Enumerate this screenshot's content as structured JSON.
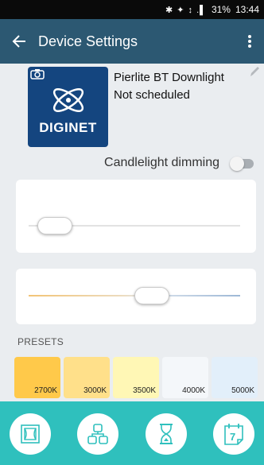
{
  "status_bar": {
    "icons": "✱ ✦ ↕ .▌",
    "battery": "31%",
    "time": "13:44"
  },
  "app_bar": {
    "title": "Device Settings",
    "back_icon": "arrow-left-icon",
    "menu_icon": "more-vert-icon"
  },
  "device": {
    "logo_text": "DIGINET",
    "name": "Pierlite BT Downlight",
    "schedule_status": "Not scheduled"
  },
  "candlelight": {
    "label": "Candlelight dimming",
    "enabled": false
  },
  "brightness_slider": {
    "value": 0.05
  },
  "temperature_slider": {
    "value": 0.6
  },
  "presets": {
    "label": "PRESETS",
    "items": [
      {
        "label": "2700K",
        "color": "#ffc94a"
      },
      {
        "label": "3000K",
        "color": "#ffe08a"
      },
      {
        "label": "3500K",
        "color": "#fff7b5"
      },
      {
        "label": "4000K",
        "color": "#f4f7fa"
      },
      {
        "label": "5000K",
        "color": "#e2effa"
      }
    ]
  },
  "bottom_nav": [
    {
      "name": "scenes-icon"
    },
    {
      "name": "groups-icon"
    },
    {
      "name": "timer-icon"
    },
    {
      "name": "schedule-icon",
      "label": "7"
    }
  ],
  "colors": {
    "app_bar": "#2c5872",
    "bottom_bar": "#2fc0bd",
    "logo_bg": "#14457f"
  }
}
